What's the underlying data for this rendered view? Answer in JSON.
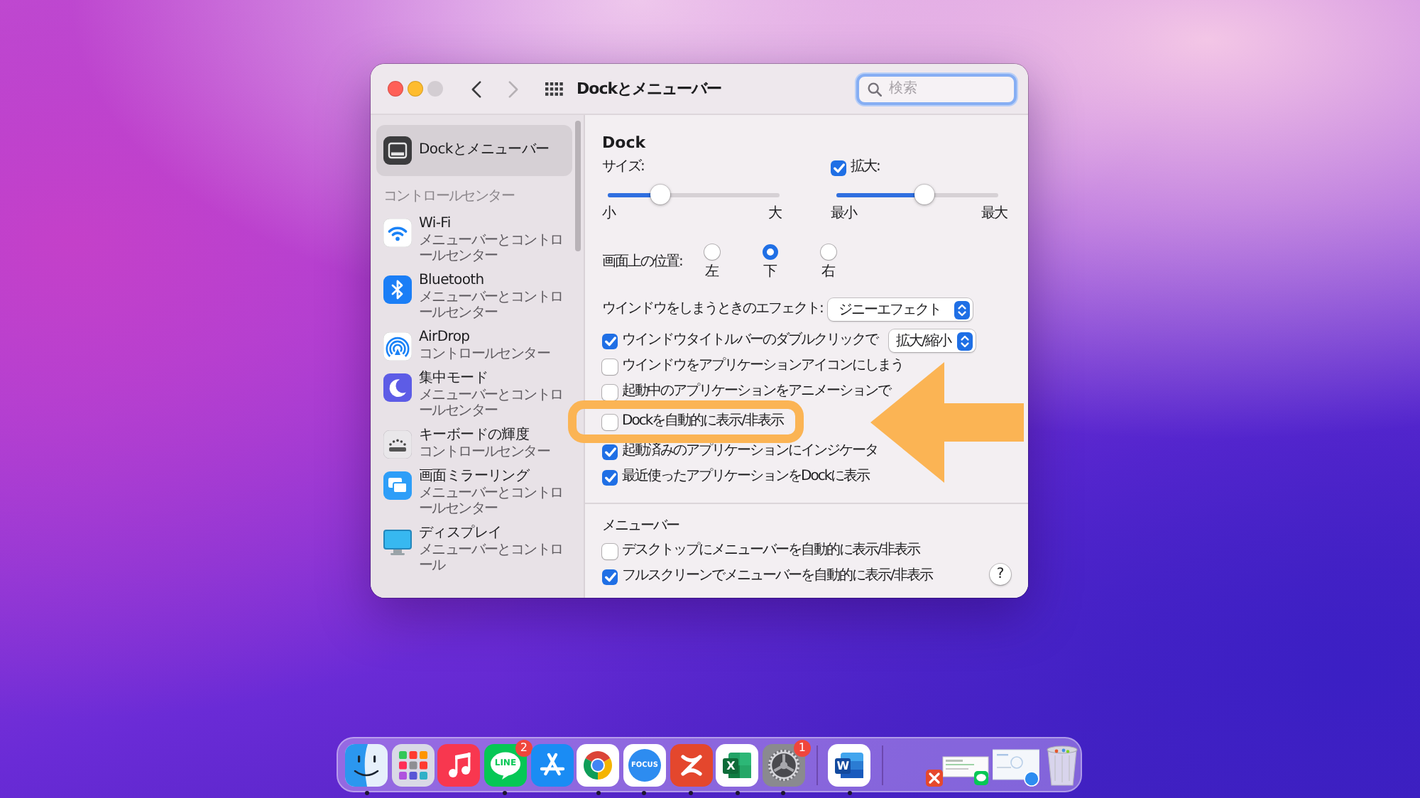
{
  "window": {
    "title": "Dockとメニューバー",
    "zoom_disabled": true,
    "forward_disabled": true,
    "search": {
      "placeholder": "検索",
      "focused": true
    }
  },
  "sidebar": {
    "items": [
      {
        "kind": "dock",
        "title": "Dockとメニューバー",
        "selected": true
      }
    ],
    "sections": [
      {
        "title": "コントロールセンター",
        "items": [
          {
            "kind": "wifi",
            "title": "Wi-Fi",
            "subtitle": "メニューバーとコントロールセンター",
            "selected": false
          },
          {
            "kind": "bluetooth",
            "title": "Bluetooth",
            "subtitle": "メニューバーとコントロールセンター",
            "selected": false
          },
          {
            "kind": "airdrop",
            "title": "AirDrop",
            "subtitle": "コントロールセンター",
            "selected": false
          },
          {
            "kind": "focus",
            "title": "集中モード",
            "subtitle": "メニューバーとコントロールセンター",
            "selected": false
          },
          {
            "kind": "keyboard",
            "title": "キーボードの輝度",
            "subtitle": "コントロールセンター",
            "selected": false
          },
          {
            "kind": "mirroring",
            "title": "画面ミラーリング",
            "subtitle": "メニューバーとコントロールセンター",
            "selected": false
          },
          {
            "kind": "display",
            "title": "ディスプレイ",
            "subtitle": "メニューバーとコントロール",
            "selected": false
          }
        ]
      }
    ]
  },
  "settings": {
    "dock": {
      "title": "Dock",
      "size": {
        "label": "サイズ:",
        "level": 0.28,
        "min_label": "小",
        "max_label": "大"
      },
      "magnification": {
        "label": "拡大:",
        "checked": true,
        "level": 0.55,
        "min_label": "最小",
        "max_label": "最大"
      },
      "position": {
        "label": "画面上の位置:",
        "options": [
          {
            "label": "左",
            "selected": false
          },
          {
            "label": "下",
            "selected": true
          },
          {
            "label": "右",
            "selected": false
          }
        ]
      },
      "minimize_effect": {
        "label": "ウインドウをしまうときのエフェクト:",
        "value": "ジニーエフェクト"
      },
      "options": [
        {
          "label": "ウインドウタイトルバーのダブルクリックで",
          "checked": true,
          "highlighted": false,
          "popup": "拡大/縮小"
        },
        {
          "label": "ウインドウをアプリケーションアイコンにしまう",
          "checked": false,
          "highlighted": false
        },
        {
          "label": "起動中のアプリケーションをアニメーションで",
          "checked": false,
          "highlighted": false
        },
        {
          "label": "Dockを自動的に表示/非表示",
          "checked": false,
          "highlighted": true
        },
        {
          "label": "起動済みのアプリケーションにインジケータ",
          "checked": true,
          "highlighted": false
        },
        {
          "label": "最近使ったアプリケーションをDockに表示",
          "checked": true,
          "highlighted": false
        }
      ]
    },
    "menu_bar": {
      "title": "メニューバー",
      "options": [
        {
          "label": "デスクトップにメニューバーを自動的に表示/非表示",
          "checked": false
        },
        {
          "label": "フルスクリーンでメニューバーを自動的に表示/非表示",
          "checked": true
        }
      ]
    },
    "help_button": "?"
  },
  "dock_bar": {
    "items": [
      {
        "kind": "finder",
        "running": true
      },
      {
        "kind": "launchpad",
        "running": false
      },
      {
        "kind": "music",
        "running": false
      },
      {
        "kind": "line",
        "logo_text": "LINE",
        "badge": "2",
        "running": true
      },
      {
        "kind": "appstore",
        "running": false
      },
      {
        "kind": "chrome",
        "running": true
      },
      {
        "kind": "focus",
        "logo_text": "FOCUS",
        "running": true
      },
      {
        "kind": "red_app",
        "running": true
      },
      {
        "kind": "excel",
        "logo_text": "X",
        "running": true
      },
      {
        "kind": "settings",
        "badge": "1",
        "running": true
      },
      {
        "kind": "separator"
      },
      {
        "kind": "word",
        "logo_text": "W",
        "running": true
      },
      {
        "kind": "separator"
      },
      {
        "kind": "window_thumb",
        "app_badges": [
          {
            "kind": "red_app"
          },
          {
            "kind": "line"
          }
        ]
      },
      {
        "kind": "window_thumb",
        "app_badges": [
          {
            "kind": "focus"
          }
        ]
      },
      {
        "kind": "trash"
      }
    ]
  }
}
